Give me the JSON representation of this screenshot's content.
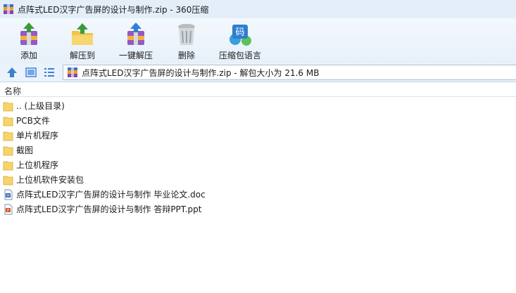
{
  "window": {
    "title": "点阵式LED汉字广告屏的设计与制作.zip - 360压缩"
  },
  "toolbar": {
    "add_label": "添加",
    "extract_to_label": "解压到",
    "one_click_extract_label": "一键解压",
    "delete_label": "删除",
    "encoding_label": "压缩包语言",
    "encoding_icon_text": "码"
  },
  "addressbar": {
    "text": "点阵式LED汉字广告屏的设计与制作.zip - 解包大小为 21.6 MB"
  },
  "list": {
    "column_name": "名称",
    "items": [
      {
        "name": ".. (上级目录)",
        "icon": "folder-icon"
      },
      {
        "name": "PCB文件",
        "icon": "folder-icon"
      },
      {
        "name": "单片机程序",
        "icon": "folder-icon"
      },
      {
        "name": "截图",
        "icon": "folder-icon"
      },
      {
        "name": "上位机程序",
        "icon": "folder-icon"
      },
      {
        "name": "上位机软件安装包",
        "icon": "folder-icon"
      },
      {
        "name": "点阵式LED汉字广告屏的设计与制作 毕业论文.doc",
        "icon": "word-document-icon"
      },
      {
        "name": "点阵式LED汉字广告屏的设计与制作 答辩PPT.ppt",
        "icon": "powerpoint-document-icon"
      }
    ]
  },
  "colors": {
    "titlebar_bg": "#e3eef9",
    "toolbar_bg": "#eaf2fb",
    "folder_yellow": "#f7d36b",
    "accent_blue": "#3c7fd3"
  }
}
